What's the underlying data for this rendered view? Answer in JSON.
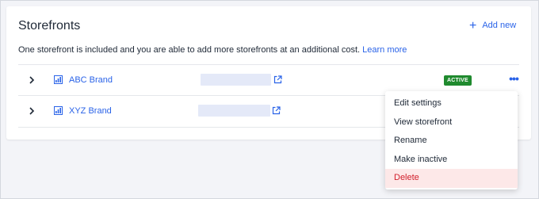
{
  "header": {
    "title": "Storefronts",
    "add_new_label": "Add new"
  },
  "description": {
    "text": "One storefront is included and you are able to add more storefronts at an additional cost.",
    "link_label": "Learn more"
  },
  "storefronts": [
    {
      "name": "ABC Brand",
      "status": "ACTIVE"
    },
    {
      "name": "XYZ Brand",
      "status": ""
    }
  ],
  "menu": {
    "items": [
      "Edit settings",
      "View storefront",
      "Rename",
      "Make inactive",
      "Delete"
    ]
  },
  "colors": {
    "accent": "#2a63e8",
    "active_badge": "#1f8a2e",
    "danger": "#d21f2b"
  }
}
